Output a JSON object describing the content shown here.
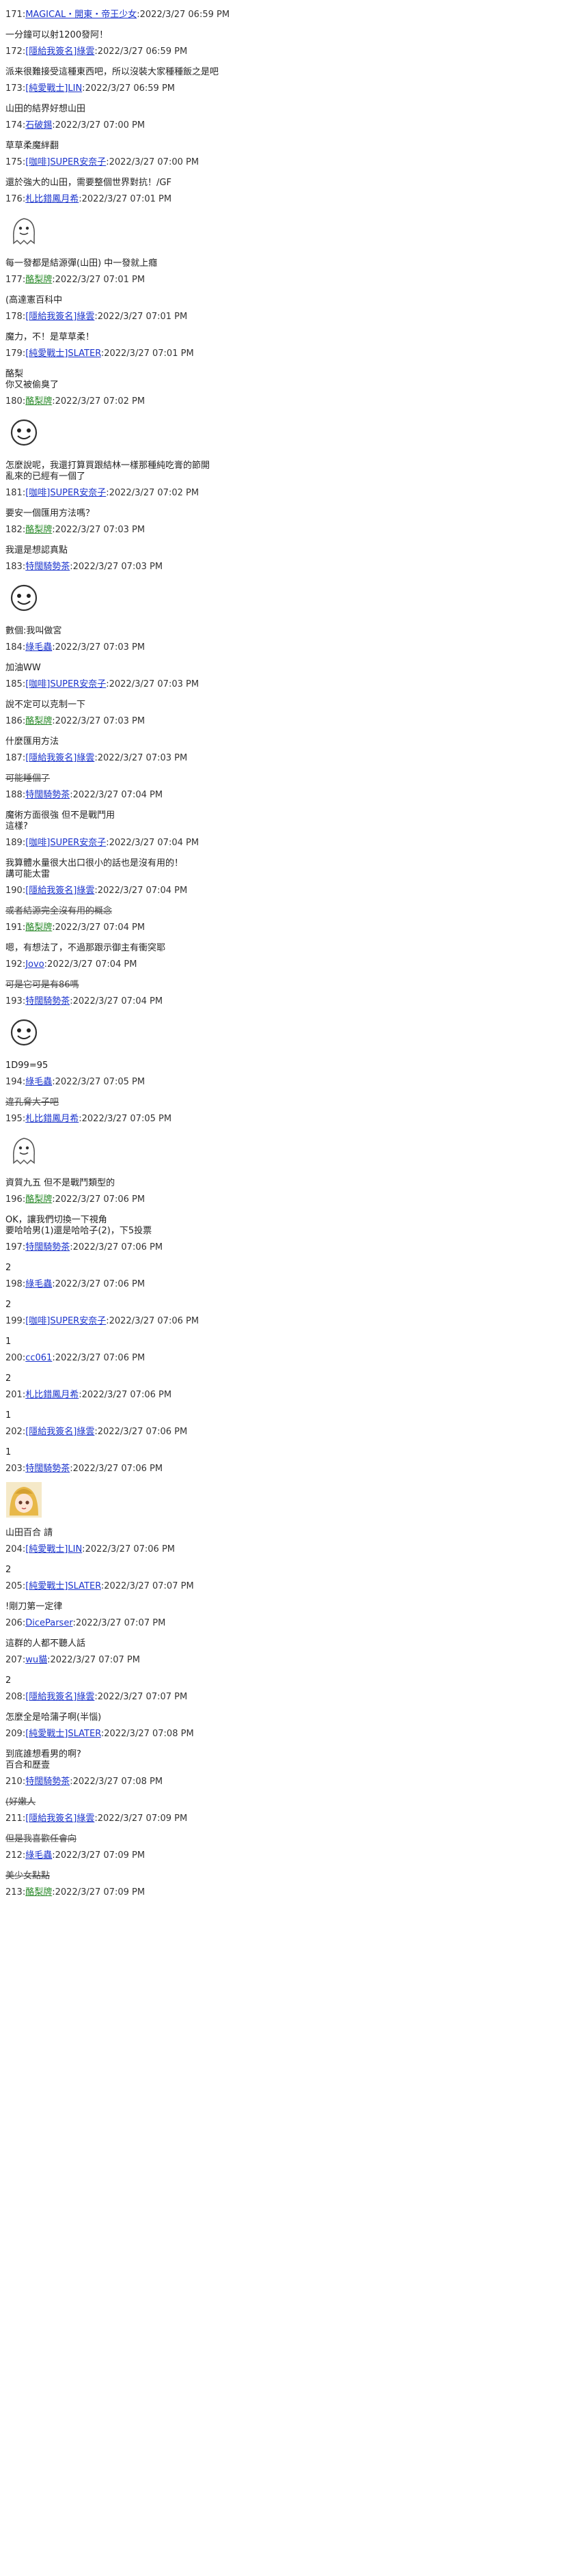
{
  "posts": [
    {
      "n": "171",
      "user": "MAGICAL・開東・帝王少女",
      "time": "2022/3/27 06:59 PM",
      "body": "一分鐘可以射1200發阿！"
    },
    {
      "n": "172",
      "user": "[隱給我簽名]綠雲",
      "time": "2022/3/27 06:59 PM",
      "body": "派来很難接受這種東西吧，所以沒裝大家種種飯之是吧"
    },
    {
      "n": "173",
      "user": "[純愛戰士]LIN",
      "time": "2022/3/27 06:59 PM",
      "body": "山田的結界好想山田"
    },
    {
      "n": "174",
      "user": "石破錫",
      "time": "2022/3/27 07:00 PM",
      "body": "草草柔魔絆翻"
    },
    {
      "n": "175",
      "user": "[咖啡]SUPER安奈子",
      "time": "2022/3/27 07:00 PM",
      "body": "還於強大的山田，需要整個世界對抗！/GF"
    },
    {
      "n": "176",
      "user": "札比錯鳳月希",
      "time": "2022/3/27 07:01 PM",
      "body": "",
      "sticker": "ghost"
    },
    {
      "n": "",
      "user": "",
      "time": "",
      "body": "每一發都是結源彈(山田) 中一發就上癮"
    },
    {
      "n": "177",
      "user": "酪梨牌",
      "time": "2022/3/27 07:01 PM",
      "body": "(高達憲百科中"
    },
    {
      "n": "178",
      "user": "[隱給我簽名]綠雲",
      "time": "2022/3/27 07:01 PM",
      "body": "魔力，不！是草草柔！"
    },
    {
      "n": "179",
      "user": "[純愛戰士]SLATER",
      "time": "2022/3/27 07:01 PM",
      "body": "酪梨\n你又被偷臭了"
    },
    {
      "n": "180",
      "user": "酪梨牌",
      "time": "2022/3/27 07:02 PM",
      "body": "",
      "sticker": "face"
    },
    {
      "n": "",
      "user": "",
      "time": "",
      "body": "怎麼說呢，我還打算買跟結林一樣那種純吃膏的節開\n亂來的已經有一個了"
    },
    {
      "n": "181",
      "user": "[咖啡]SUPER安奈子",
      "time": "2022/3/27 07:02 PM",
      "body": "要安一個匯用方法嗎？"
    },
    {
      "n": "182",
      "user": "酪梨牌",
      "time": "2022/3/27 07:03 PM",
      "body": "我還是想認真點"
    },
    {
      "n": "183",
      "user": "特闊騎勢茶",
      "time": "2022/3/27 07:03 PM",
      "body": "",
      "sticker": "face"
    },
    {
      "n": "",
      "user": "",
      "time": "",
      "body": "數個:我叫做宮"
    },
    {
      "n": "184",
      "user": "綠毛蟲",
      "time": "2022/3/27 07:03 PM",
      "body": "加油WW"
    },
    {
      "n": "185",
      "user": "[咖啡]SUPER安奈子",
      "time": "2022/3/27 07:03 PM",
      "body": "說不定可以克制一下"
    },
    {
      "n": "186",
      "user": "酪梨牌",
      "time": "2022/3/27 07:03 PM",
      "body": "什麼匯用方法"
    },
    {
      "n": "187",
      "user": "[隱給我簽名]綠雲",
      "time": "2022/3/27 07:03 PM",
      "body": "可能睡個了",
      "strike": true
    },
    {
      "n": "188",
      "user": "特闊騎勢茶",
      "time": "2022/3/27 07:04 PM",
      "body": "魔術方面很強 但不是戰鬥用\n這樣?"
    },
    {
      "n": "189",
      "user": "[咖啡]SUPER安奈子",
      "time": "2022/3/27 07:04 PM",
      "body": "我算體水量很大出口很小的話也是沒有用的！\n講可能太雷"
    },
    {
      "n": "190",
      "user": "[隱給我簽名]綠雲",
      "time": "2022/3/27 07:04 PM",
      "body": "或者結源完全沒有用的概念",
      "strike": true
    },
    {
      "n": "191",
      "user": "酪梨牌",
      "time": "2022/3/27 07:04 PM",
      "body": "嗯，有想法了，不過那跟示御主有衝突耶"
    },
    {
      "n": "192",
      "user": "Jovo",
      "time": "2022/3/27 07:04 PM",
      "body": "可是它可是有86嗎",
      "strike": true
    },
    {
      "n": "193",
      "user": "特闊騎勢茶",
      "time": "2022/3/27 07:04 PM",
      "body": "",
      "sticker": "face"
    },
    {
      "n": "",
      "user": "",
      "time": "",
      "body": "1D99=95"
    },
    {
      "n": "194",
      "user": "綠毛蟲",
      "time": "2022/3/27 07:05 PM",
      "body": "違孔脅大子吧",
      "strike": true
    },
    {
      "n": "195",
      "user": "札比錯鳳月希",
      "time": "2022/3/27 07:05 PM",
      "body": "",
      "sticker": "ghost"
    },
    {
      "n": "",
      "user": "",
      "time": "",
      "body": "資質九五 但不是戰鬥類型的"
    },
    {
      "n": "196",
      "user": "酪梨牌",
      "time": "2022/3/27 07:06 PM",
      "body": "OK，讓我們切換一下視角\n要哈哈男(1)還是哈哈子(2)，下5投票"
    },
    {
      "n": "197",
      "user": "特闊騎勢茶",
      "time": "2022/3/27 07:06 PM",
      "body": "2"
    },
    {
      "n": "198",
      "user": "綠毛蟲",
      "time": "2022/3/27 07:06 PM",
      "body": "2"
    },
    {
      "n": "199",
      "user": "[咖啡]SUPER安奈子",
      "time": "2022/3/27 07:06 PM",
      "body": "1"
    },
    {
      "n": "200",
      "user": "cc061",
      "time": "2022/3/27 07:06 PM",
      "body": "2"
    },
    {
      "n": "201",
      "user": "札比錯鳳月希",
      "time": "2022/3/27 07:06 PM",
      "body": "1"
    },
    {
      "n": "202",
      "user": "[隱給我簽名]綠雲",
      "time": "2022/3/27 07:06 PM",
      "body": "1"
    },
    {
      "n": "203",
      "user": "特闊騎勢茶",
      "time": "2022/3/27 07:06 PM",
      "body": "",
      "sticker": "anime"
    },
    {
      "n": "",
      "user": "",
      "time": "",
      "body": "山田百合 請"
    },
    {
      "n": "204",
      "user": "[純愛戰士]LIN",
      "time": "2022/3/27 07:06 PM",
      "body": "2"
    },
    {
      "n": "205",
      "user": "[純愛戰士]SLATER",
      "time": "2022/3/27 07:07 PM",
      "body": "!剛刀第一定律"
    },
    {
      "n": "206",
      "user": "DiceParser",
      "time": "2022/3/27 07:07 PM",
      "body": "這群的人都不聽人話"
    },
    {
      "n": "207",
      "user": "wu貓",
      "time": "2022/3/27 07:07 PM",
      "body": "2"
    },
    {
      "n": "208",
      "user": "[隱給我簽名]綠雲",
      "time": "2022/3/27 07:07 PM",
      "body": "怎麼全是哈蒲子啊(半惱)"
    },
    {
      "n": "209",
      "user": "[純愛戰士]SLATER",
      "time": "2022/3/27 07:08 PM",
      "body": "到底誰想看男的啊?\n百合和歷壹"
    },
    {
      "n": "210",
      "user": "特闊騎勢茶",
      "time": "2022/3/27 07:08 PM",
      "body": "(好嫩人",
      "strike": true
    },
    {
      "n": "211",
      "user": "[隱給我簽名]綠雲",
      "time": "2022/3/27 07:09 PM",
      "body": "但是我喜歡任會向",
      "strike": true
    },
    {
      "n": "212",
      "user": "綠毛蟲",
      "time": "2022/3/27 07:09 PM",
      "body": "美少女點點",
      "strike": true
    },
    {
      "n": "213",
      "user": "酪梨牌",
      "time": "2022/3/27 07:09 PM",
      "body": ""
    }
  ],
  "icons": {
    "ghost": "ghost-sticker-icon",
    "face": "blob-face-sticker-icon",
    "anime": "anime-girl-sticker-icon"
  }
}
